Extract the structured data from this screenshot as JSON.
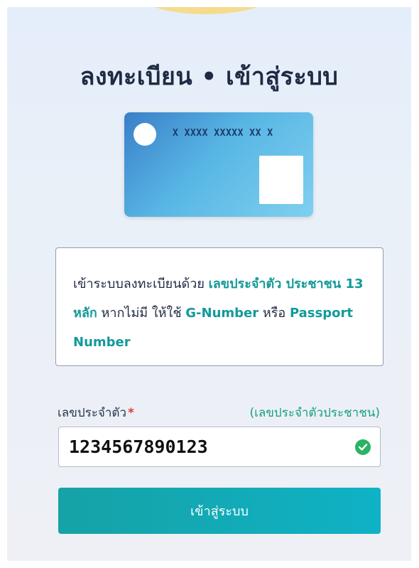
{
  "header": {
    "title": "ลงทะเบียน • เข้าสู่ระบบ"
  },
  "card": {
    "number": "X XXXX XXXXX XX X"
  },
  "info": {
    "t1": "เข้าระบบลงทะเบียนด้วย ",
    "h1": "เลขประจำตัว ประชาชน 13 หลัก",
    "t2": " หากไม่มี ให้ใช้ ",
    "h2": "G-Number",
    "t3": " หรือ ",
    "h3": "Passport Number"
  },
  "form": {
    "label": "เลขประจำตัว",
    "required_mark": "*",
    "hint": "(เลขประจำตัวประชาชน)",
    "id_value": "1234567890123",
    "submit_label": "เข้าสู่ระบบ"
  },
  "colors": {
    "accent": "#139a9a",
    "success": "#28b463",
    "button": "#16a2a6",
    "required": "#e03b3b"
  }
}
